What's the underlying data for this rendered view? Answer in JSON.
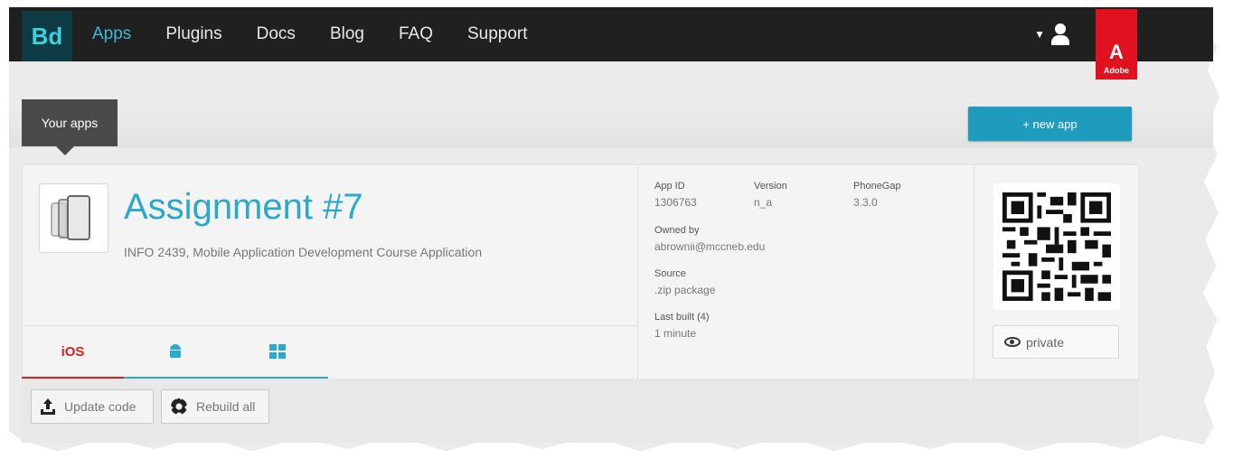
{
  "nav": {
    "logo": "Bd",
    "links": [
      "Apps",
      "Plugins",
      "Docs",
      "Blog",
      "FAQ",
      "Support"
    ],
    "active": "Apps",
    "adobe_label": "Adobe",
    "adobe_mark": "A"
  },
  "apps_bar": {
    "tab_label": "Your apps",
    "new_app_label": "+ new app"
  },
  "app": {
    "title": "Assignment #7",
    "description": "INFO 2439, Mobile Application Development Course Application",
    "meta": {
      "app_id_label": "App ID",
      "app_id": "1306763",
      "version_label": "Version",
      "version": "n_a",
      "phonegap_label": "PhoneGap",
      "phonegap": "3.3.0",
      "owned_by_label": "Owned by",
      "owned_by": "abrownii@mccneb.edu",
      "source_label": "Source",
      "source": ".zip package",
      "last_built_label": "Last built (4)",
      "last_built": "1 minute"
    },
    "platform_tabs": [
      "iOS",
      "android-icon",
      "windows-icon"
    ],
    "active_platform": "iOS",
    "private_label": "private"
  },
  "actions": {
    "update_code": "Update code",
    "rebuild_all": "Rebuild all"
  },
  "colors": {
    "accent": "#2aa9c9",
    "ios_red": "#d62027",
    "nav_bg": "#202020",
    "adobe_red": "#e0121f",
    "button_blue": "#1e9bbd"
  }
}
